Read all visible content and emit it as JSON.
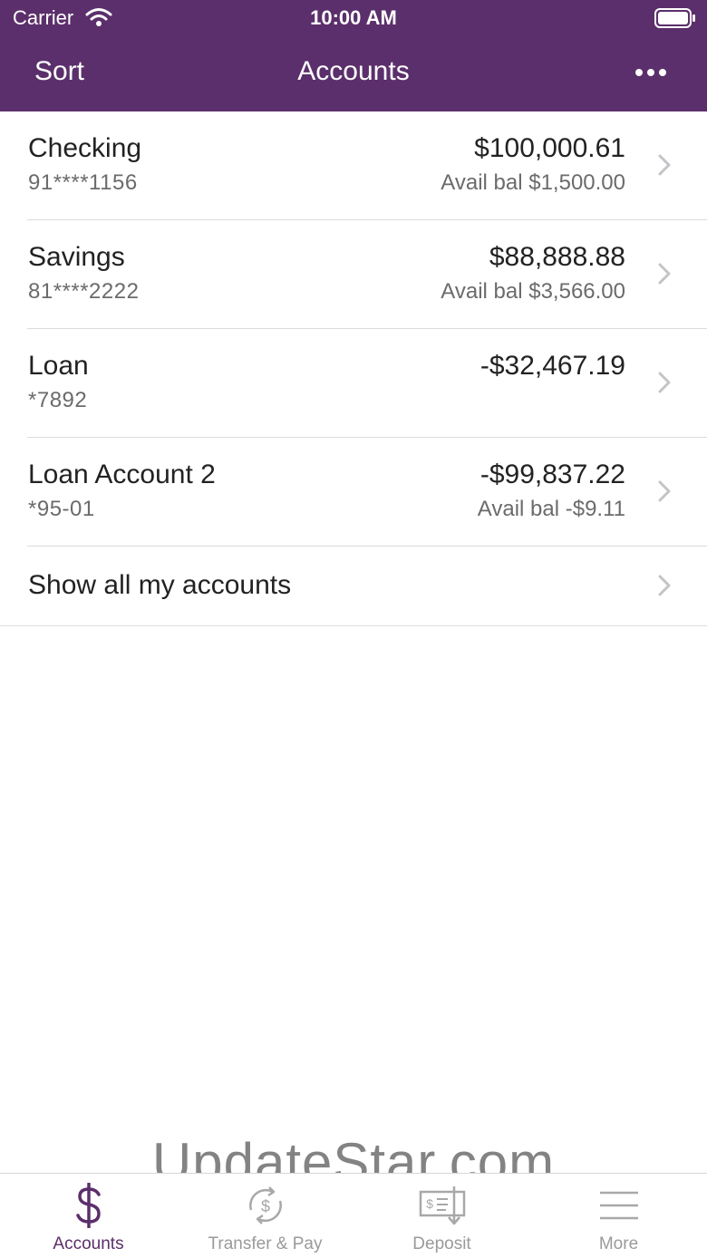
{
  "status_bar": {
    "carrier": "Carrier",
    "time": "10:00 AM"
  },
  "nav": {
    "sort_label": "Sort",
    "title": "Accounts"
  },
  "accounts": [
    {
      "name": "Checking",
      "number": "91****1156",
      "balance": "$100,000.61",
      "avail": "Avail bal $1,500.00"
    },
    {
      "name": "Savings",
      "number": "81****2222",
      "balance": "$88,888.88",
      "avail": "Avail bal $3,566.00"
    },
    {
      "name": "Loan",
      "number": "*7892",
      "balance": "-$32,467.19",
      "avail": ""
    },
    {
      "name": "Loan Account 2",
      "number": "*95-01",
      "balance": "-$99,837.22",
      "avail": "Avail bal -$9.11"
    }
  ],
  "show_all": {
    "label": "Show all my accounts"
  },
  "watermark": "UpdateStar.com",
  "tabs": [
    {
      "label": "Accounts",
      "icon": "dollar-icon",
      "active": true
    },
    {
      "label": "Transfer & Pay",
      "icon": "transfer-icon",
      "active": false
    },
    {
      "label": "Deposit",
      "icon": "check-deposit-icon",
      "active": false
    },
    {
      "label": "More",
      "icon": "menu-icon",
      "active": false
    }
  ],
  "colors": {
    "brand": "#5b2f6b",
    "tab_inactive": "#9a9a9a",
    "text_secondary": "#6b6b6b"
  }
}
